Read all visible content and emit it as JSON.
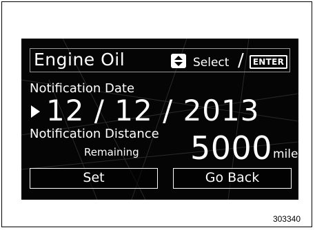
{
  "screen": {
    "title": "Engine Oil",
    "select_label": "Select",
    "separator": "/",
    "enter_label": "ENTER",
    "notification_date": {
      "label": "Notification Date",
      "value": "12 / 12 / 2013"
    },
    "notification_distance": {
      "label": "Notification Distance",
      "sublabel": "Remaining",
      "value": "5000",
      "unit": "miles"
    },
    "buttons": {
      "set": "Set",
      "go_back": "Go Back"
    }
  },
  "figure_code": "303340",
  "icons": [
    "up-down-select-icon",
    "pointer-arrow-icon"
  ],
  "colors": {
    "screen_bg": "#050505",
    "text": "#ffffff",
    "frame_border": "#9a9a9a"
  }
}
